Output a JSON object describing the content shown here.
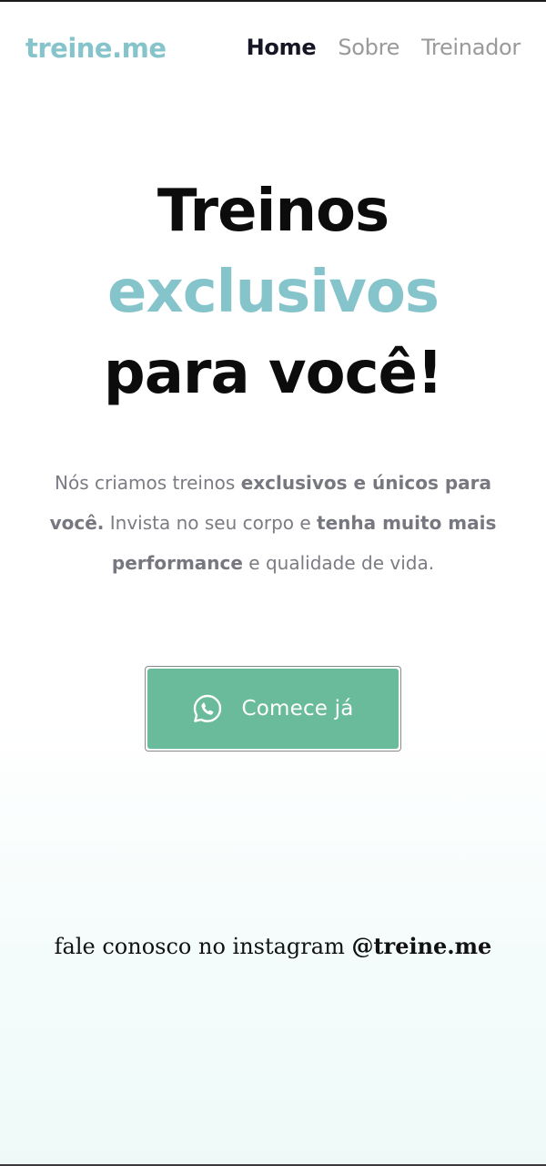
{
  "nav": {
    "logo": "treine.me",
    "links": [
      "Home",
      "Sobre",
      "Treinador"
    ],
    "active": "Home"
  },
  "hero": {
    "title_line1": "Treinos",
    "title_accent": "exclusivos",
    "title_line3": "para você!",
    "text": {
      "p1": "Nós criamos treinos ",
      "b1": "exclusivos e únicos para você.",
      "p2": " Invista no seu corpo e ",
      "b2": "tenha muito mais performance",
      "p3": " e qualidade de vida."
    }
  },
  "cta": {
    "label": "Comece já",
    "icon": "whatsapp-icon"
  },
  "footer": {
    "prefix": "fale conosco no instagram ",
    "handle": "@treine.me"
  },
  "colors": {
    "accent": "#86c4cb",
    "button": "#6aba9c",
    "nav_active": "#161626",
    "nav_inactive": "#9a9a9a",
    "body_text": "#7b7b83"
  }
}
